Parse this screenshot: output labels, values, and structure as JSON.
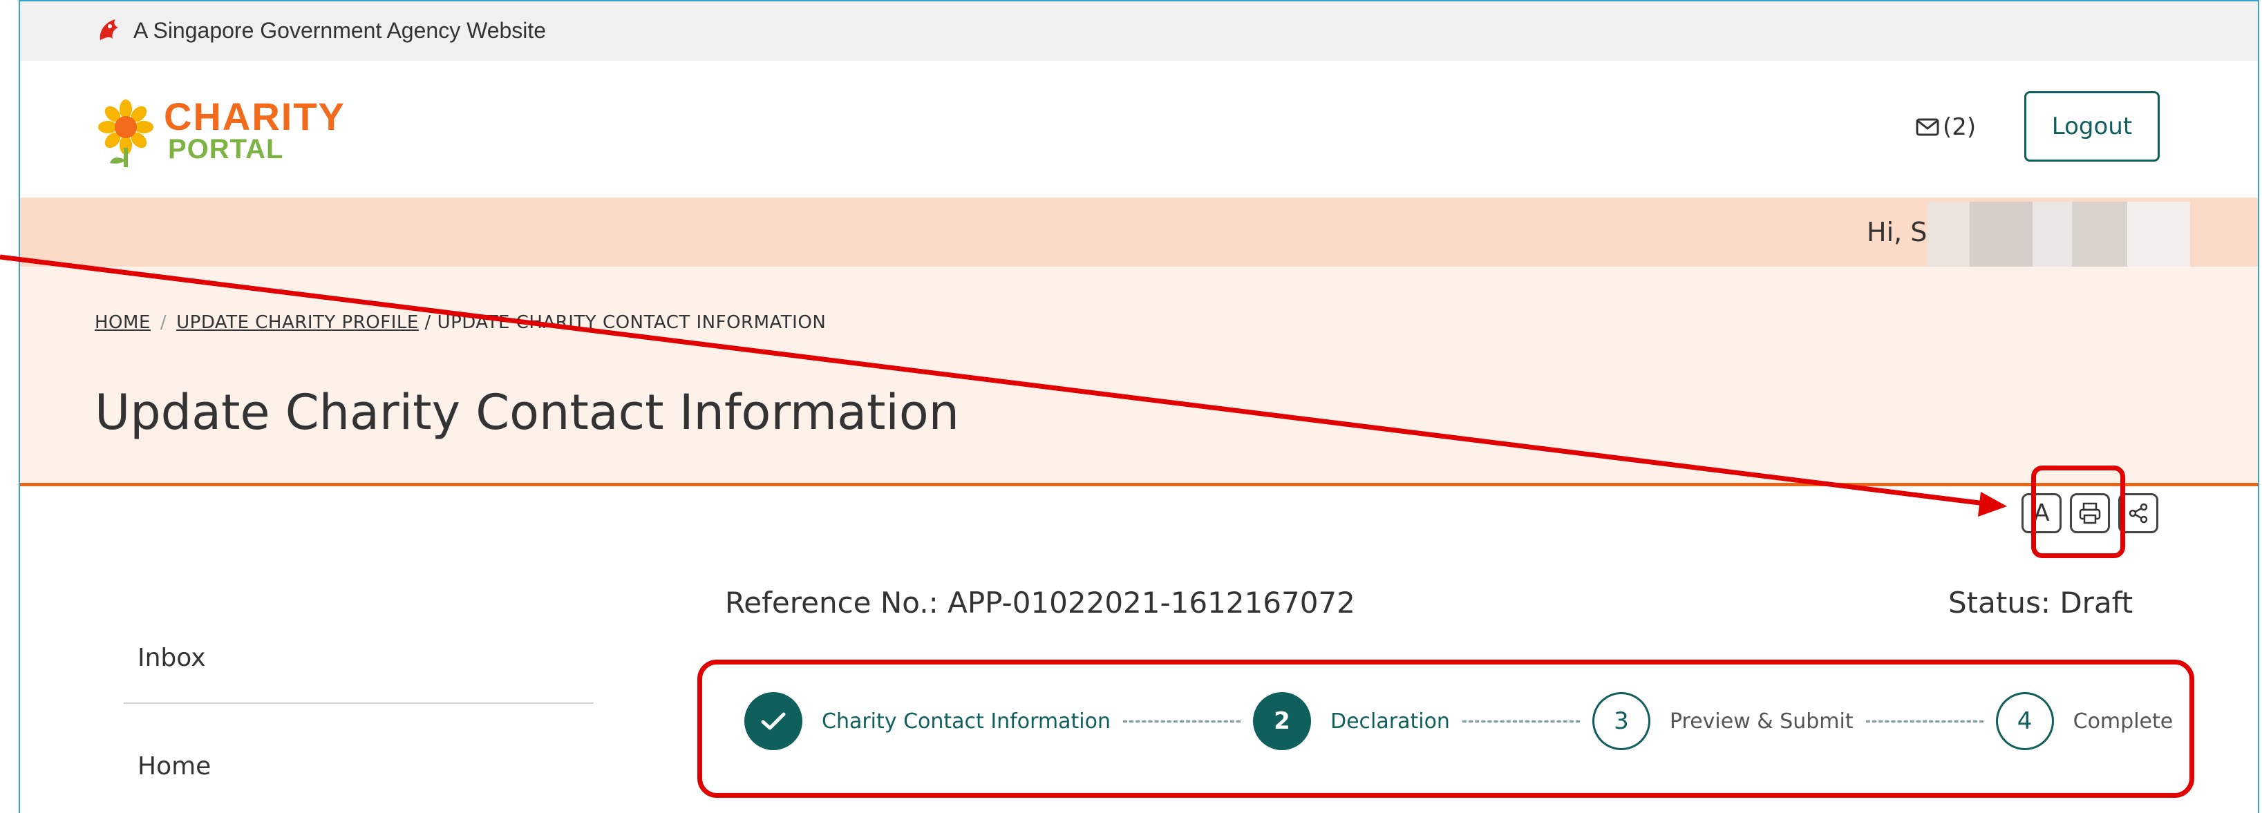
{
  "gov_bar": {
    "text": "A Singapore Government Agency Website"
  },
  "logo": {
    "line1": "CHARITY",
    "line2": "PORTAL"
  },
  "header": {
    "mail_count": "(2)",
    "logout_label": "Logout"
  },
  "greeting": {
    "prefix": "Hi, S"
  },
  "breadcrumb": {
    "home": "HOME",
    "sep": "/",
    "update_profile": "UPDATE CHARITY PROFILE",
    "current": "/ UPDATE CHARITY CONTACT INFORMATION"
  },
  "page_title": "Update Charity Contact Information",
  "tools": {
    "font_label": "A"
  },
  "sidebar": {
    "items": [
      {
        "label": "Inbox"
      },
      {
        "label": "Home"
      }
    ]
  },
  "reference": {
    "label": "Reference No.:",
    "value": "APP-01022021-1612167072"
  },
  "status": {
    "label": "Status:",
    "value": "Draft"
  },
  "steps": [
    {
      "number": "✓",
      "label": "Charity Contact Information",
      "state": "done"
    },
    {
      "number": "2",
      "label": "Declaration",
      "state": "active"
    },
    {
      "number": "3",
      "label": "Preview & Submit",
      "state": "todo"
    },
    {
      "number": "4",
      "label": "Complete",
      "state": "todo"
    }
  ],
  "colors": {
    "brand_teal": "#0f5f5c",
    "accent_orange": "#e8651c",
    "annotation_red": "#e00000"
  },
  "icons": {
    "mail": "envelope-icon",
    "print": "printer-icon",
    "share": "share-icon",
    "font": "font-size-icon"
  }
}
